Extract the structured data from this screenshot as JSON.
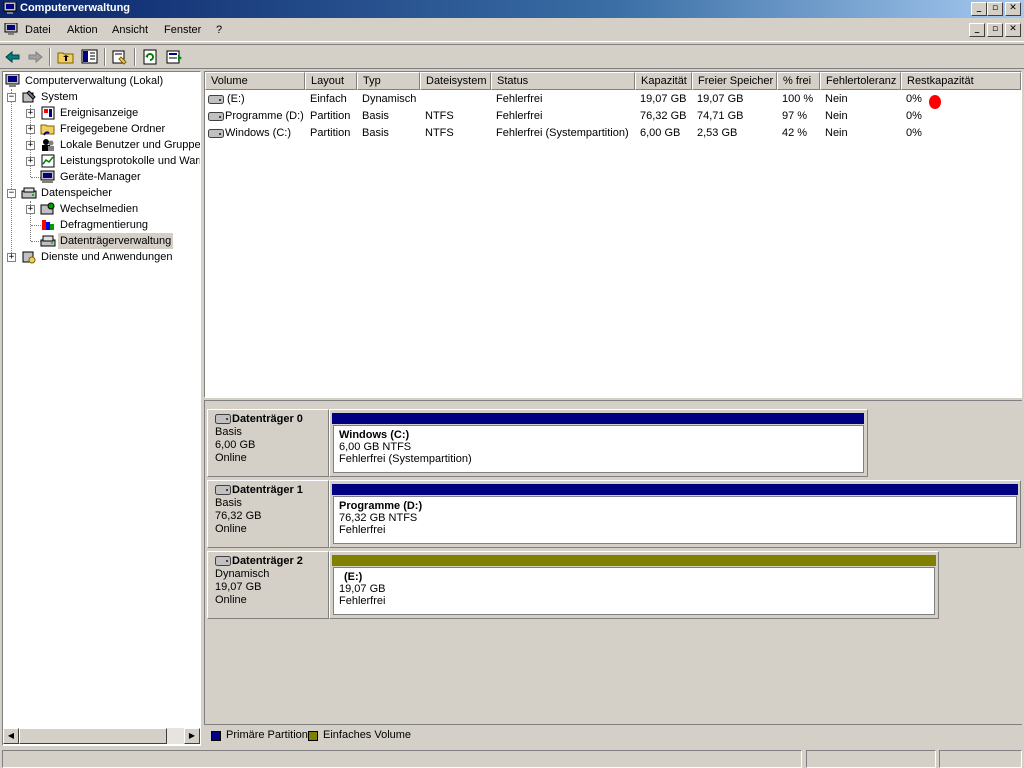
{
  "window": {
    "title": "Computerverwaltung",
    "caption_buttons": [
      "_",
      "▫",
      "✕"
    ]
  },
  "menu": {
    "items": [
      "Datei",
      "Aktion",
      "Ansicht",
      "Fenster",
      "?"
    ],
    "mdi_buttons": [
      "_",
      "▫",
      "✕"
    ]
  },
  "toolbar": {
    "icons": [
      "back-arrow-icon",
      "forward-arrow-icon",
      "up-folder-icon",
      "show-hide-tree-icon",
      "properties-icon",
      "refresh-icon",
      "export-list-icon"
    ]
  },
  "tree": {
    "root": "Computerverwaltung (Lokal)",
    "system": {
      "label": "System",
      "children": [
        "Ereignisanzeige",
        "Freigegebene Ordner",
        "Lokale Benutzer und Gruppen",
        "Leistungsprotokolle und Warnungen",
        "Geräte-Manager"
      ]
    },
    "storage": {
      "label": "Datenspeicher",
      "children": [
        "Wechselmedien",
        "Defragmentierung",
        "Datenträgerverwaltung"
      ]
    },
    "services": "Dienste und Anwendungen",
    "selected": "Datenträgerverwaltung"
  },
  "volume_list": {
    "columns": [
      "Volume",
      "Layout",
      "Typ",
      "Dateisystem",
      "Status",
      "Kapazität",
      "Freier Speicher",
      "% frei",
      "Fehlertoleranz",
      "Restkapazität"
    ],
    "rows": [
      [
        "(E:)",
        "Einfach",
        "Dynamisch",
        "",
        "Fehlerfrei",
        "19,07 GB",
        "19,07 GB",
        "100 %",
        "Nein",
        "0%"
      ],
      [
        "Programme (D:)",
        "Partition",
        "Basis",
        "NTFS",
        "Fehlerfrei",
        "76,32 GB",
        "74,71 GB",
        "97 %",
        "Nein",
        "0%"
      ],
      [
        "Windows (C:)",
        "Partition",
        "Basis",
        "NTFS",
        "Fehlerfrei (Systempartition)",
        "6,00 GB",
        "2,53 GB",
        "42 %",
        "Nein",
        "0%"
      ]
    ]
  },
  "disks": [
    {
      "name": "Datenträger 0",
      "type": "Basis",
      "size": "6,00 GB",
      "status": "Online",
      "partition": {
        "name": "Windows  (C:)",
        "detail": "6,00 GB NTFS",
        "status": "Fehlerfrei (Systempartition)",
        "color": "#000080"
      }
    },
    {
      "name": "Datenträger 1",
      "type": "Basis",
      "size": "76,32 GB",
      "status": "Online",
      "partition": {
        "name": "Programme  (D:)",
        "detail": "76,32 GB NTFS",
        "status": "Fehlerfrei",
        "color": "#000080"
      }
    },
    {
      "name": "Datenträger 2",
      "type": "Dynamisch",
      "size": "19,07 GB",
      "status": "Online",
      "partition": {
        "name": "(E:)",
        "detail": "19,07 GB",
        "status": "Fehlerfrei",
        "color": "#808000"
      }
    }
  ],
  "legend": {
    "items": [
      {
        "label": "Primäre Partition",
        "color": "#000080"
      },
      {
        "label": "Einfaches Volume",
        "color": "#808000"
      }
    ]
  },
  "colors": {
    "title_start": "#0a246a",
    "title_end": "#a6caf0",
    "annotation_red": "#ff0000"
  }
}
